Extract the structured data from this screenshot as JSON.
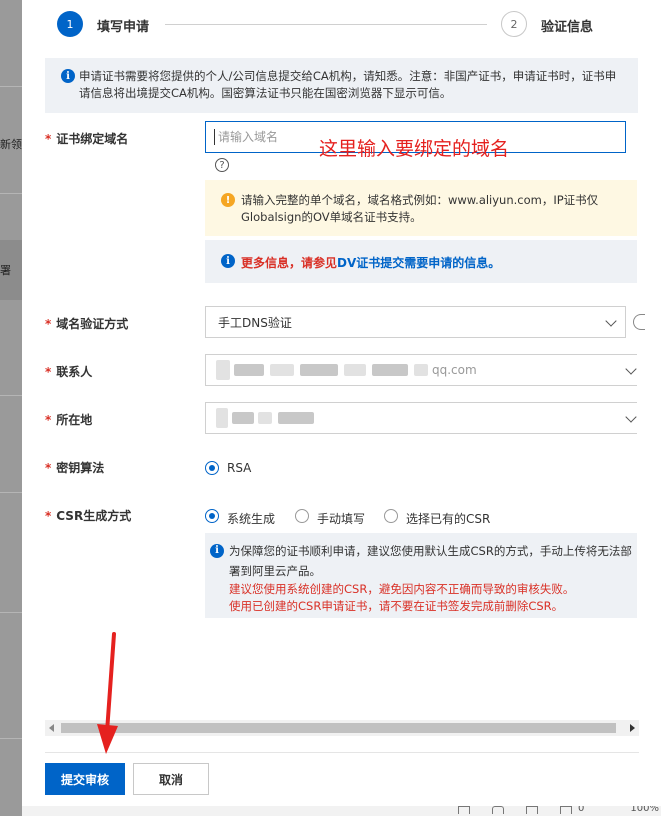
{
  "background_page": {
    "fragments": [
      "新领",
      "署"
    ]
  },
  "steps": [
    {
      "number": "1",
      "label": "填写申请"
    },
    {
      "number": "2",
      "label": "验证信息"
    }
  ],
  "notice": {
    "icon": "info-icon",
    "text": "申请证书需要将您提供的个人/公司信息提交给CA机构，请知悉。注意：非国产证书，申请证书时，证书申请信息将出境提交CA机构。国密算法证书只能在国密浏览器下显示可信。"
  },
  "domain": {
    "label": "证书绑定域名",
    "required_mark": "*",
    "placeholder": "请输入域名",
    "annotation": "这里输入要绑定的域名",
    "help_glyph": "?",
    "warning": "请输入完整的单个域名，域名格式例如：www.aliyun.com，IP证书仅Globalsign的OV单域名证书支持。",
    "more_prefix": "更多信息，请参见",
    "more_link": "DV证书提交需要申请的信息",
    "more_suffix": "。"
  },
  "verify_method": {
    "label": "域名验证方式",
    "required_mark": "*",
    "value": "手工DNS验证"
  },
  "contact": {
    "label": "联系人",
    "required_mark": "*",
    "visible_suffix": "qq.com"
  },
  "location": {
    "label": "所在地",
    "required_mark": "*"
  },
  "key_algorithm": {
    "label": "密钥算法",
    "required_mark": "*",
    "options": [
      "RSA"
    ],
    "selected": "RSA"
  },
  "csr_method": {
    "label": "CSR生成方式",
    "required_mark": "*",
    "options": [
      "系统生成",
      "手动填写",
      "选择已有的CSR"
    ],
    "selected": "系统生成",
    "info_line1": "为保障您的证书顺利申请，建议您使用默认生成CSR的方式，手动上传将无法部署到阿里云产品。",
    "warn_line1": "建议您使用系统创建的CSR，避免因内容不正确而导致的审核失败。",
    "warn_line2": "使用已创建的CSR申请证书，请不要在证书签发完成前删除CSR。"
  },
  "footer": {
    "submit_label": "提交审核",
    "cancel_label": "取消"
  },
  "statusbar": {
    "zoom": "100%",
    "count": "0"
  },
  "colors": {
    "primary": "#0064c8",
    "annotation_red": "#e5211f",
    "warning_bg": "#fef8e3",
    "info_bg": "#eef1f5"
  }
}
